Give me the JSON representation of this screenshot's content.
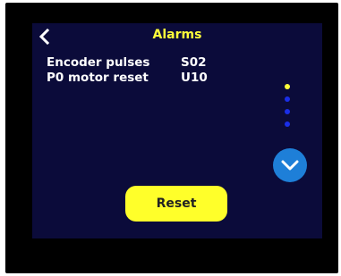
{
  "header": {
    "title": "Alarms",
    "back_icon": "chevron-left-icon"
  },
  "alarms": [
    {
      "name": "Encoder pulses",
      "code": "S02"
    },
    {
      "name": "P0 motor reset",
      "code": "U10"
    }
  ],
  "pagination": {
    "current_page": 1,
    "total_pages": 4
  },
  "scroll_down": {
    "icon": "chevron-down-icon"
  },
  "reset_button": {
    "label": "Reset"
  },
  "colors": {
    "screen_background": "#0b0b3a",
    "title": "#ffff3a",
    "text": "#ffffff",
    "accent_button": "#ffff2a",
    "scroll_button": "#1e7fd8",
    "dot_active": "#ffff3a",
    "dot_inactive": "#1a2ee8"
  }
}
